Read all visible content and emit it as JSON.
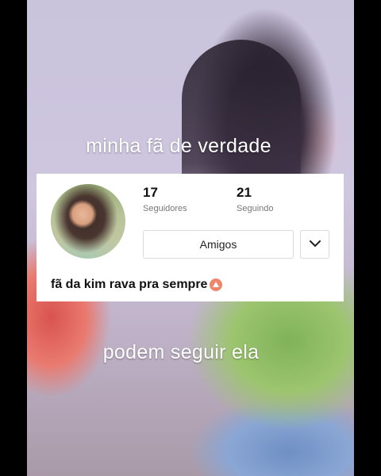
{
  "captions": {
    "top": "minha fã de verdade",
    "bottom": "podem seguir ela"
  },
  "profile": {
    "followers": {
      "count": "17",
      "label": "Seguidores"
    },
    "following": {
      "count": "21",
      "label": "Seguindo"
    },
    "friends_button": "Amigos",
    "more_icon": "chevron-down-icon",
    "bio": "fã da kim rava pra sempre",
    "bio_icon": "orange-triangle-emoji"
  }
}
